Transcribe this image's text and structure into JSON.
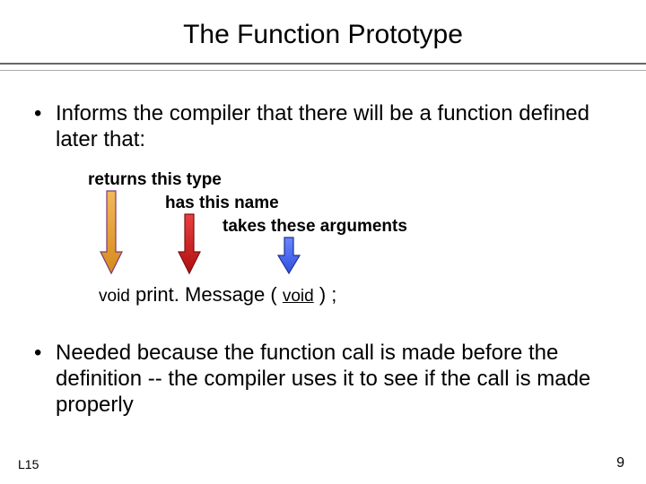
{
  "title": "The Function Prototype",
  "bullets": {
    "b1": "Informs the compiler that there will be a function defined later that:",
    "b2": "Needed because the function call is made before the definition -- the compiler uses it to see if the call is made properly"
  },
  "labels": {
    "returns": "returns this type",
    "hasname": "has this name",
    "takes": "takes these arguments"
  },
  "code": {
    "kw1": "void",
    "fname": "print. Message",
    "paren_open": "(",
    "arg": "void",
    "paren_close": ") ;"
  },
  "footer": {
    "left": "L15",
    "right": "9"
  },
  "arrows": {
    "orange": {
      "fill": "#e8a23a",
      "stroke": "#7c3a7c"
    },
    "red": {
      "fill": "#d01818",
      "stroke": "#7c1010"
    },
    "blue": {
      "fill": "#4060ff",
      "stroke": "#203090"
    }
  }
}
